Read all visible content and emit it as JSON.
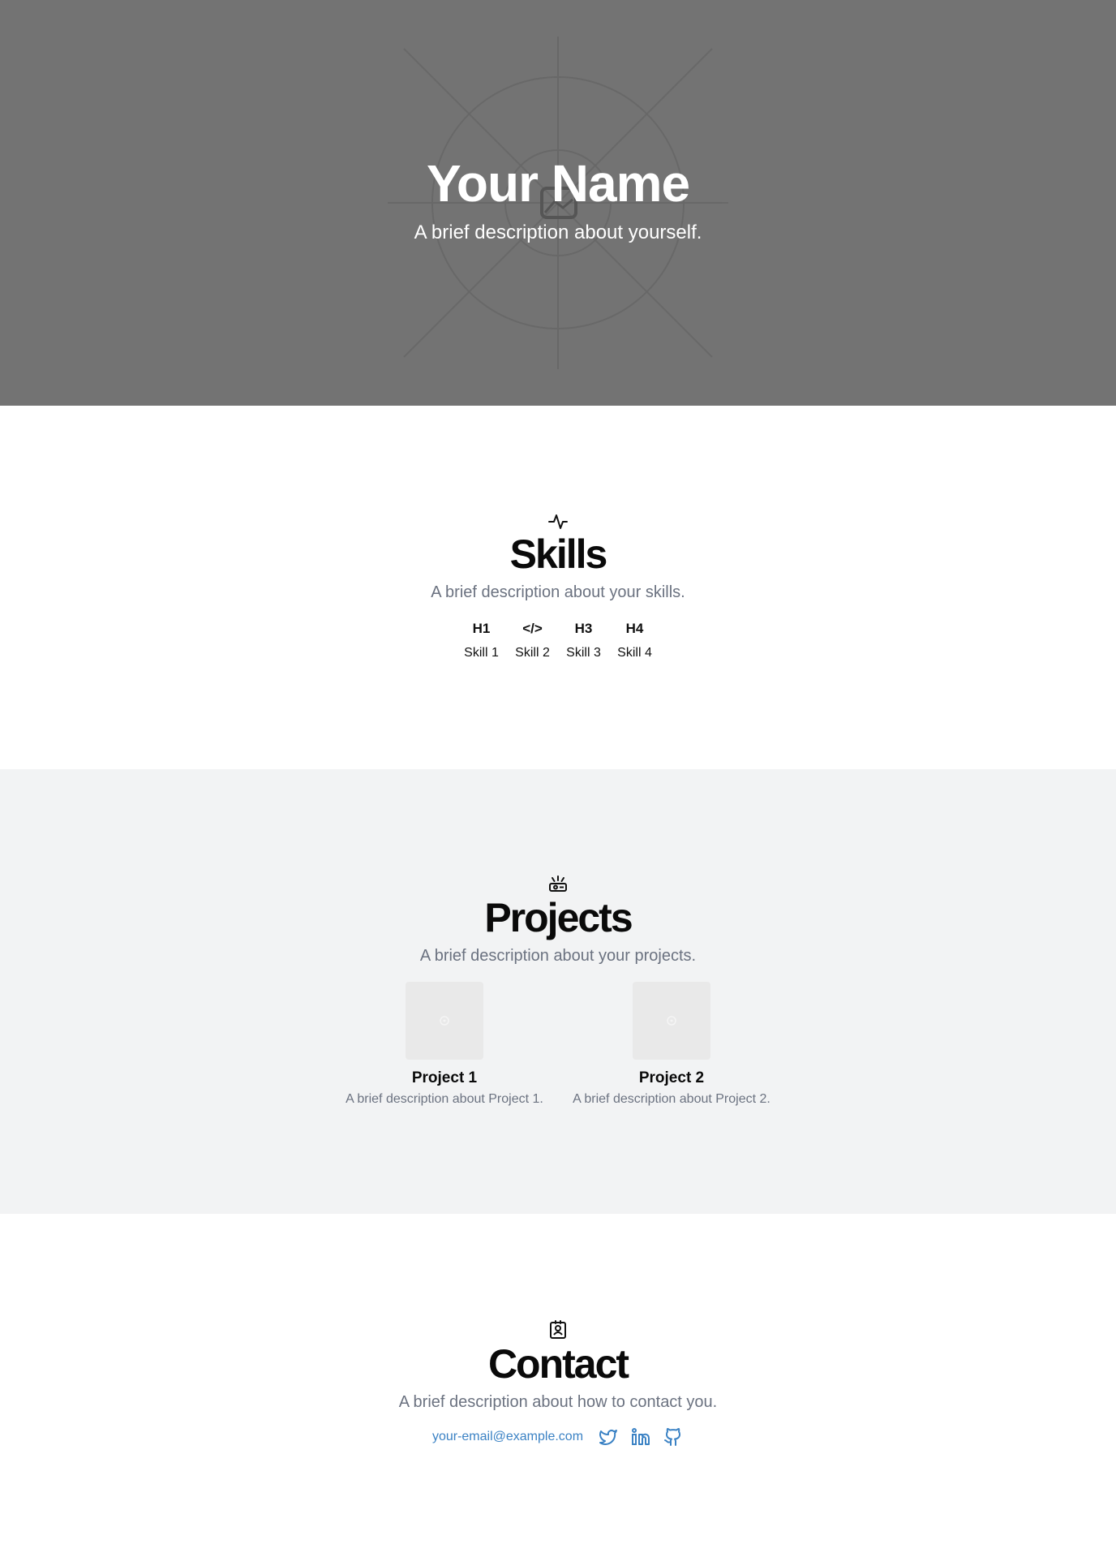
{
  "hero": {
    "title": "Your Name",
    "description": "A brief description about yourself.",
    "background_color": "#737373",
    "image_icon": "image-placeholder-icon"
  },
  "skills": {
    "icon": "activity-icon",
    "title": "Skills",
    "description": "A brief description about your skills.",
    "items": [
      {
        "glyph": "H1",
        "icon": "heading-1-icon",
        "label": "Skill 1"
      },
      {
        "glyph": "</>",
        "icon": "code-icon",
        "label": "Skill 2"
      },
      {
        "glyph": "H3",
        "icon": "heading-3-icon",
        "label": "Skill 3"
      },
      {
        "glyph": "H4",
        "icon": "heading-4-icon",
        "label": "Skill 4"
      }
    ]
  },
  "projects": {
    "icon": "projector-icon",
    "title": "Projects",
    "description": "A brief description about your projects.",
    "background_color": "#f2f3f4",
    "items": [
      {
        "name": "Project 1",
        "description": "A brief description about Project 1."
      },
      {
        "name": "Project 2",
        "description": "A brief description about Project 2."
      }
    ]
  },
  "contact": {
    "icon": "contact-card-icon",
    "title": "Contact",
    "description": "A brief description about how to contact you.",
    "email": "your-email@example.com",
    "link_color": "#3b82c4",
    "socials": [
      "twitter-icon",
      "linkedin-icon",
      "github-icon"
    ]
  }
}
